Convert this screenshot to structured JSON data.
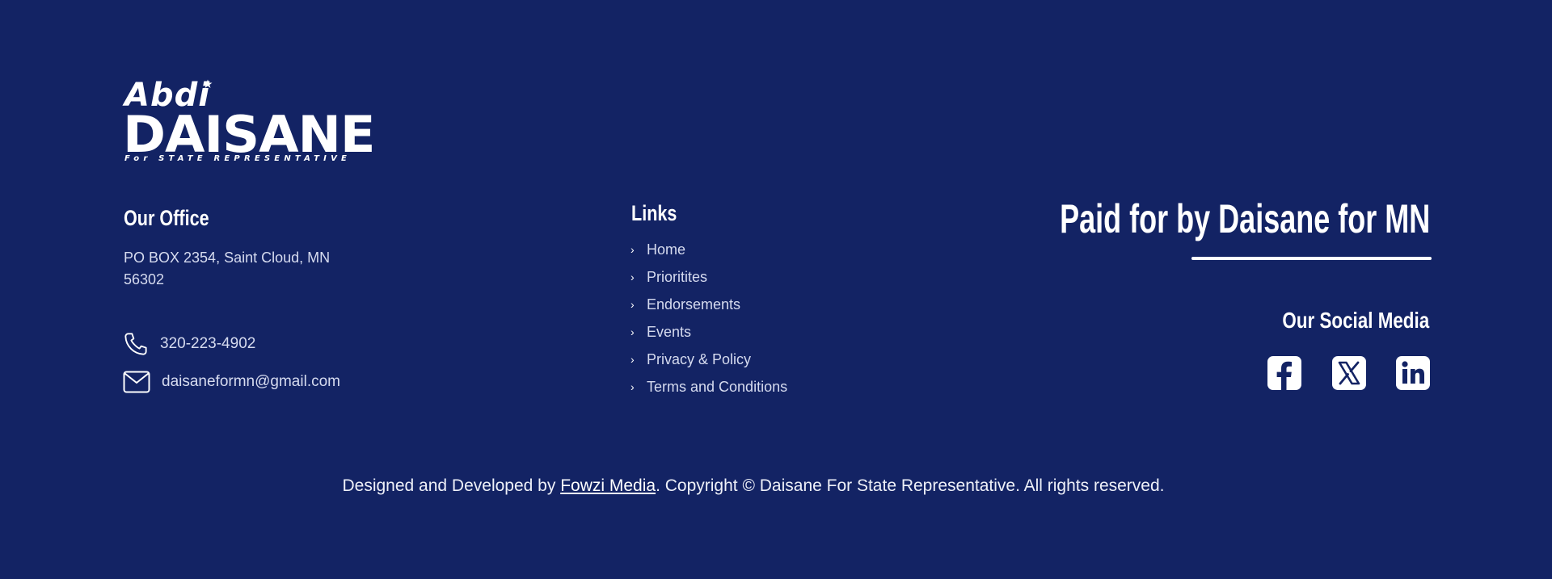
{
  "logo": {
    "first_name": "Abdi",
    "last_name": "DAISANE",
    "tagline": "For STATE REPRESENTATIVE"
  },
  "office": {
    "title": "Our Office",
    "address": "PO BOX 2354, Saint Cloud, MN 56302",
    "phone": "320-223-4902",
    "email": "daisaneformn@gmail.com"
  },
  "links": {
    "title": "Links",
    "items": [
      {
        "label": "Home"
      },
      {
        "label": "Prioritites"
      },
      {
        "label": "Endorsements"
      },
      {
        "label": "Events"
      },
      {
        "label": "Privacy & Policy"
      },
      {
        "label": "Terms and Conditions"
      }
    ]
  },
  "paid_for": "Paid for by Daisane for MN",
  "social": {
    "title": "Our Social Media",
    "icons": [
      "facebook-icon",
      "x-twitter-icon",
      "linkedin-icon"
    ]
  },
  "footer": {
    "prefix": "Designed and Developed by ",
    "link_text": "Fowzi Media",
    "suffix": ". Copyright © Daisane For State Representative. All rights reserved."
  },
  "colors": {
    "background": "#132364",
    "text": "#ffffff",
    "muted_text": "#d6dbef"
  }
}
